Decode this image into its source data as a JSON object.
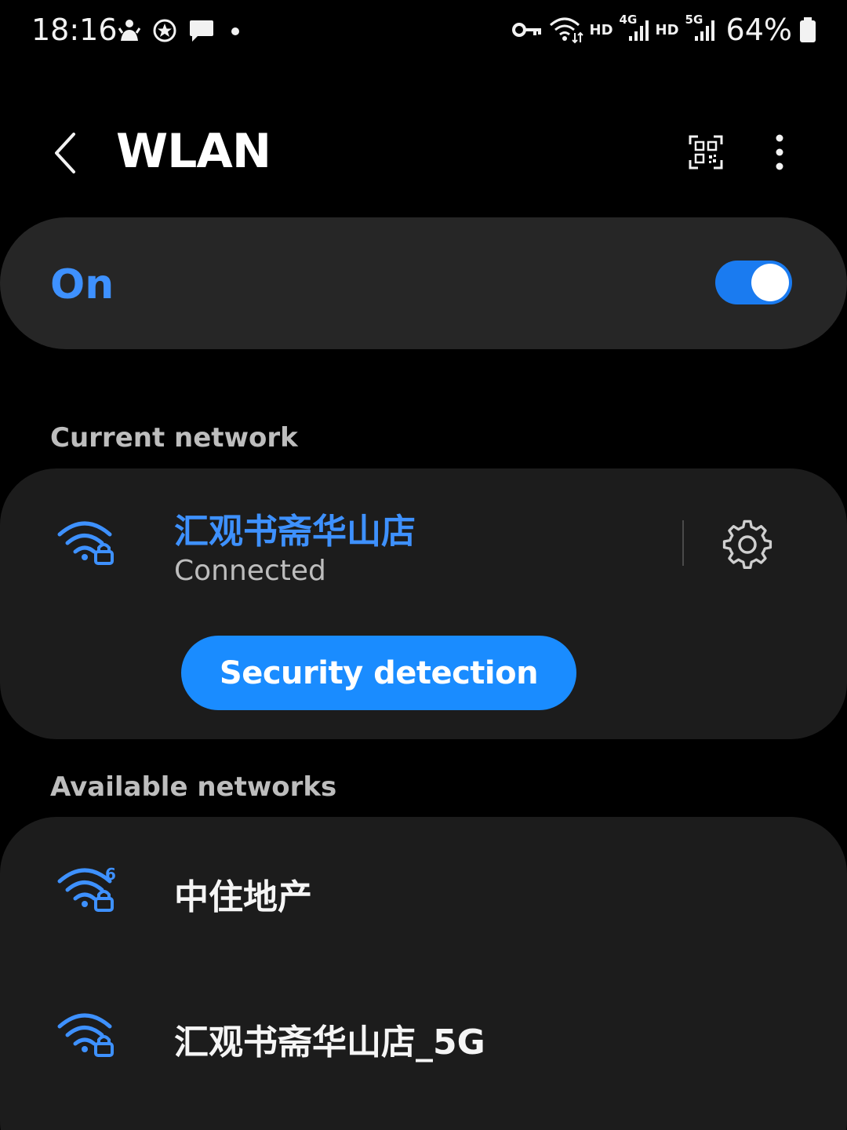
{
  "status_bar": {
    "time": "18:16",
    "left_icons": [
      "notification-app-icon",
      "star-badge-icon",
      "message-icon",
      "dot-icon"
    ],
    "hd1": "HD",
    "net1": "4G",
    "hd2": "HD",
    "net2": "5G",
    "battery": "64%",
    "right_icons": [
      "vpn-key-icon",
      "wifi-activity-icon",
      "signal-icon",
      "signal-icon",
      "battery-icon"
    ]
  },
  "header": {
    "title": "WLAN",
    "icons": [
      "back-icon",
      "qr-scan-icon",
      "more-vert-icon"
    ]
  },
  "master_toggle": {
    "label": "On",
    "checked": true
  },
  "current_network": {
    "section_label": "Current network",
    "name": "汇观书斋华山店",
    "status": "Connected",
    "action_label": "Security detection"
  },
  "available_networks": {
    "section_label": "Available networks",
    "items": [
      {
        "name": "中住地产",
        "wifi_standard": "6",
        "secured": true
      },
      {
        "name": "汇观书斋华山店_5G",
        "wifi_standard": "",
        "secured": true
      }
    ]
  },
  "colors": {
    "accent": "#3e91ff",
    "button": "#1a8cff",
    "card": "#1c1c1c",
    "toggle_card": "#262626",
    "background": "#000000"
  }
}
